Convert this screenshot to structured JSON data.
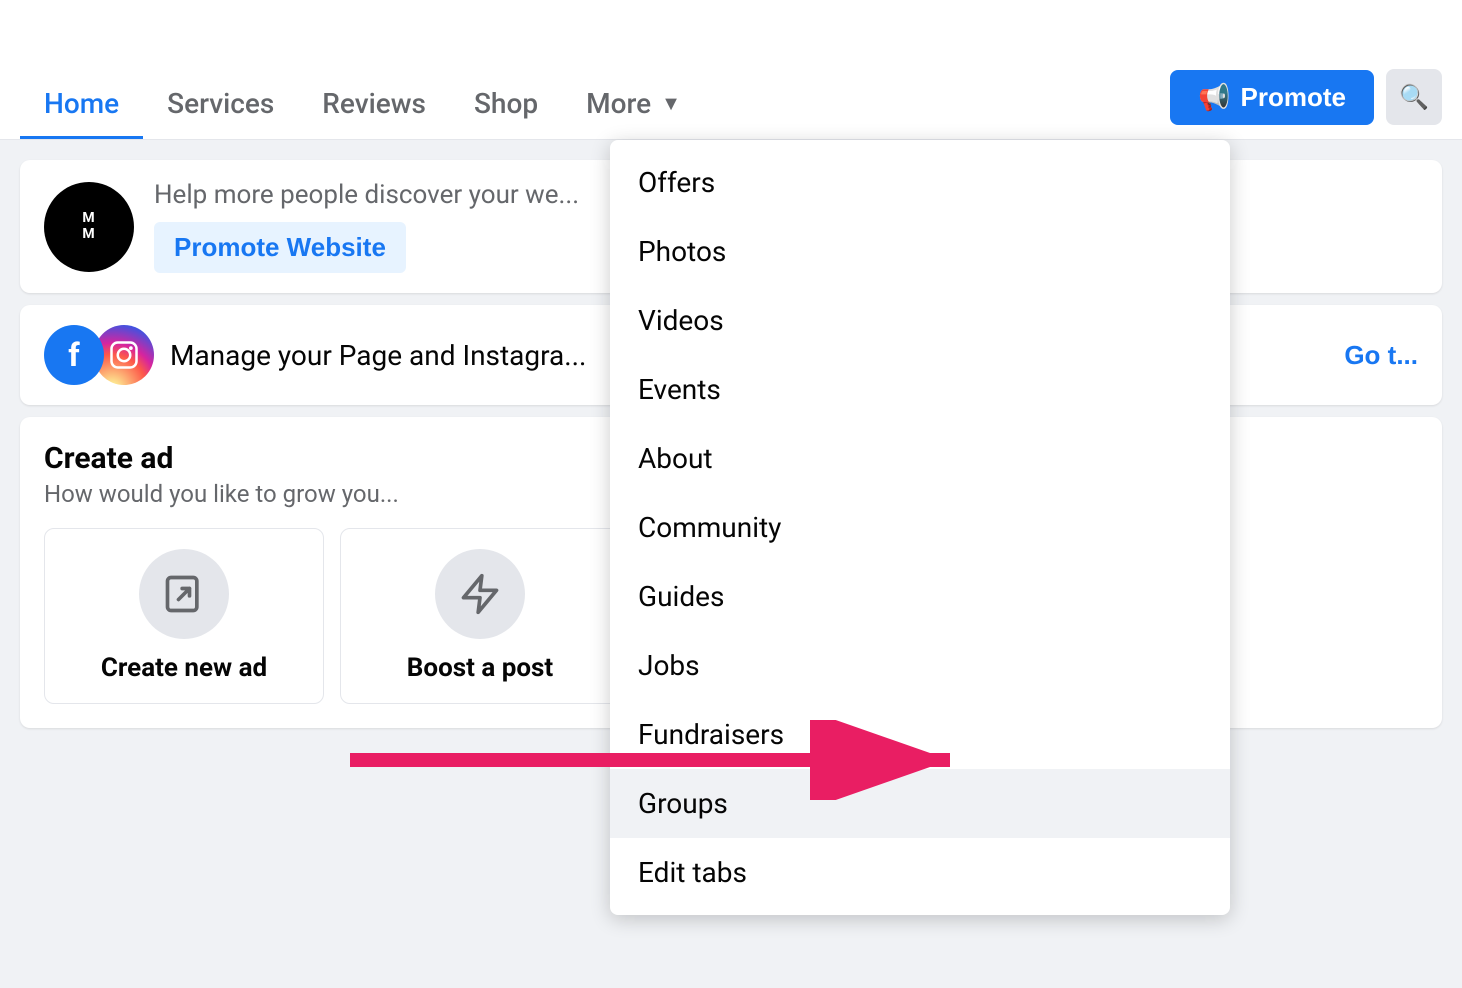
{
  "nav": {
    "tabs": [
      {
        "label": "Home",
        "active": true
      },
      {
        "label": "Services",
        "active": false
      },
      {
        "label": "Reviews",
        "active": false
      },
      {
        "label": "Shop",
        "active": false
      },
      {
        "label": "More",
        "active": false
      }
    ],
    "promote_label": "Promote",
    "search_icon": "🔍"
  },
  "card1": {
    "desc": "Help more people discover your we...",
    "promote_website_label": "Promote Website"
  },
  "card2": {
    "text": "Manage your Page and Instagra...",
    "go_to_label": "Go t..."
  },
  "create_ad": {
    "title": "Create ad",
    "subtitle": "How would you like to grow you...",
    "cards": [
      {
        "label": "Create new ad",
        "icon": "✏️"
      },
      {
        "label": "Boost a post",
        "icon": "⚡"
      }
    ]
  },
  "dropdown": {
    "items": [
      {
        "label": "Offers",
        "highlighted": false
      },
      {
        "label": "Photos",
        "highlighted": false
      },
      {
        "label": "Videos",
        "highlighted": false
      },
      {
        "label": "Events",
        "highlighted": false
      },
      {
        "label": "About",
        "highlighted": false
      },
      {
        "label": "Community",
        "highlighted": false
      },
      {
        "label": "Guides",
        "highlighted": false
      },
      {
        "label": "Jobs",
        "highlighted": false
      },
      {
        "label": "Fundraisers",
        "highlighted": false
      },
      {
        "label": "Groups",
        "highlighted": true
      },
      {
        "label": "Edit tabs",
        "highlighted": false
      }
    ]
  },
  "avatar": {
    "initials": "MM"
  }
}
